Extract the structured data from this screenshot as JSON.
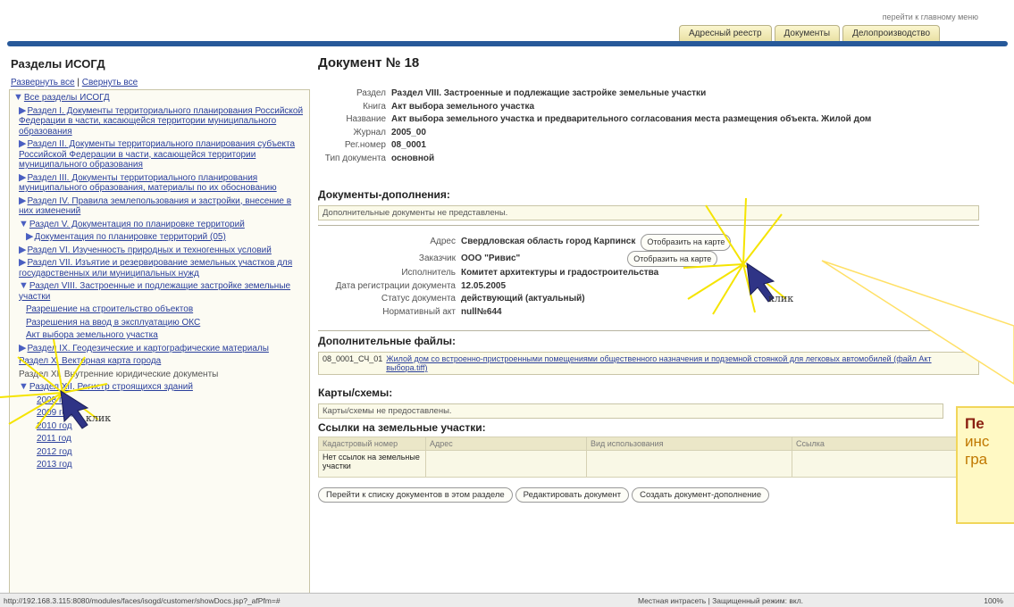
{
  "header": {
    "top_link": "перейти к главному меню",
    "tabs": [
      "Адресный реестр",
      "Документы",
      "Делопроизводство"
    ]
  },
  "left": {
    "title": "Разделы ИСОГД",
    "expand_all": "Развернуть все",
    "sep": "|",
    "collapse_all": "Свернуть все",
    "tree": {
      "root": "Все разделы ИСОГД",
      "s1": "Раздел I. Документы территориального планирования Российской Федерации в части, касающейся территории муниципального образования",
      "s2": "Раздел II. Документы территориального планирования субъекта Российской Федерации в части, касающейся территории муниципального образования",
      "s3": "Раздел III. Документы территориального планирования муниципального образования, материалы по их обоснованию",
      "s4": "Раздел IV. Правила землепользования и застройки, внесение в них изменений",
      "s5": "Раздел V. Документация по планировке территорий",
      "s5a": "Документация по планировке территорий (05)",
      "s6": "Раздел VI. Изученность природных и техногенных условий",
      "s7": "Раздел VII. Изъятие и резервирование земельных участков для государственных или муниципальных нужд",
      "s8": "Раздел VIII. Застроенные и подлежащие застройке земельные участки",
      "s8a": "Разрешение на строительство объектов",
      "s8b": "Разрешения на ввод в эксплуатацию ОКС",
      "s8c": "Акт выбора земельного участка",
      "s9": "Раздел IX. Геодезические и картографические материалы",
      "s10": "Раздел X. Векторная карта города",
      "s11": "Раздел XI. Внутренние юридические документы",
      "s12": "Раздел XII. Регистр строящихся зданий",
      "years": [
        "2008 год",
        "2009 год",
        "2010 год",
        "2011 год",
        "2012 год",
        "2013 год"
      ]
    }
  },
  "doc": {
    "title": "Документ № 18",
    "meta": [
      {
        "k": "Раздел",
        "v": "Раздел VIII. Застроенные и подлежащие застройке земельные участки"
      },
      {
        "k": "Книга",
        "v": "Акт выбора земельного участка"
      },
      {
        "k": "Название",
        "v": "Акт выбора земельного участка и предварительного согласования места размещения объекта. Жилой дом"
      },
      {
        "k": "Журнал",
        "v": "2005_00"
      },
      {
        "k": "Рег.номер",
        "v": "08_0001"
      },
      {
        "k": "Тип документа",
        "v": "основной"
      }
    ],
    "supplements_title": "Документы-дополнения:",
    "supplements_text": "Дополнительные документы не представлены.",
    "info": {
      "address_k": "Адрес",
      "address_v": "Свердловская область город Карпинск",
      "address_btn": "Отобразить на карте",
      "customer_k": "Заказчик",
      "customer_v": "ООО \"Ривис\"",
      "customer_btn": "Отобразить на карте",
      "executor_k": "Исполнитель",
      "executor_v": "Комитет архитектуры и градостроительства",
      "regdate_k": "Дата регистрации документа",
      "regdate_v": "12.05.2005",
      "status_k": "Статус документа",
      "status_v": "действующий (актуальный)",
      "norm_k": "Нормативный акт",
      "norm_v": "null№644"
    },
    "files_title": "Дополнительные файлы:",
    "file_code": "08_0001_СЧ_01",
    "file_link": "Жилой дом со встроенно-пристроенными помещениями общественного назначения и подземной стоянкой для легковых автомобилей (файл Акт выбора.tiff)",
    "maps_title": "Карты/схемы:",
    "maps_text": "Карты/схемы не предоставлены.",
    "land_title": "Ссылки на земельные участки:",
    "land_cols": [
      "Кадастровый номер",
      "Адрес",
      "Вид использования",
      "Ссылка"
    ],
    "land_empty": "Нет ссылок на земельные участки",
    "buttons": [
      "Перейти к списку документов в этом разделе",
      "Редактировать документ",
      "Создать документ-дополнение"
    ]
  },
  "annotations": {
    "click1": "клик",
    "click2": "клик",
    "callout_bold": "Пе",
    "callout_l2": "инс",
    "callout_l3": "гра"
  },
  "status": {
    "url": "http://192.168.3.115:8080/modules/faces/isogd/customer/showDocs.jsp?_afPfm=#",
    "zone": "Местная интрасеть | Защищенный режим: вкл.",
    "zoom": "100%"
  }
}
